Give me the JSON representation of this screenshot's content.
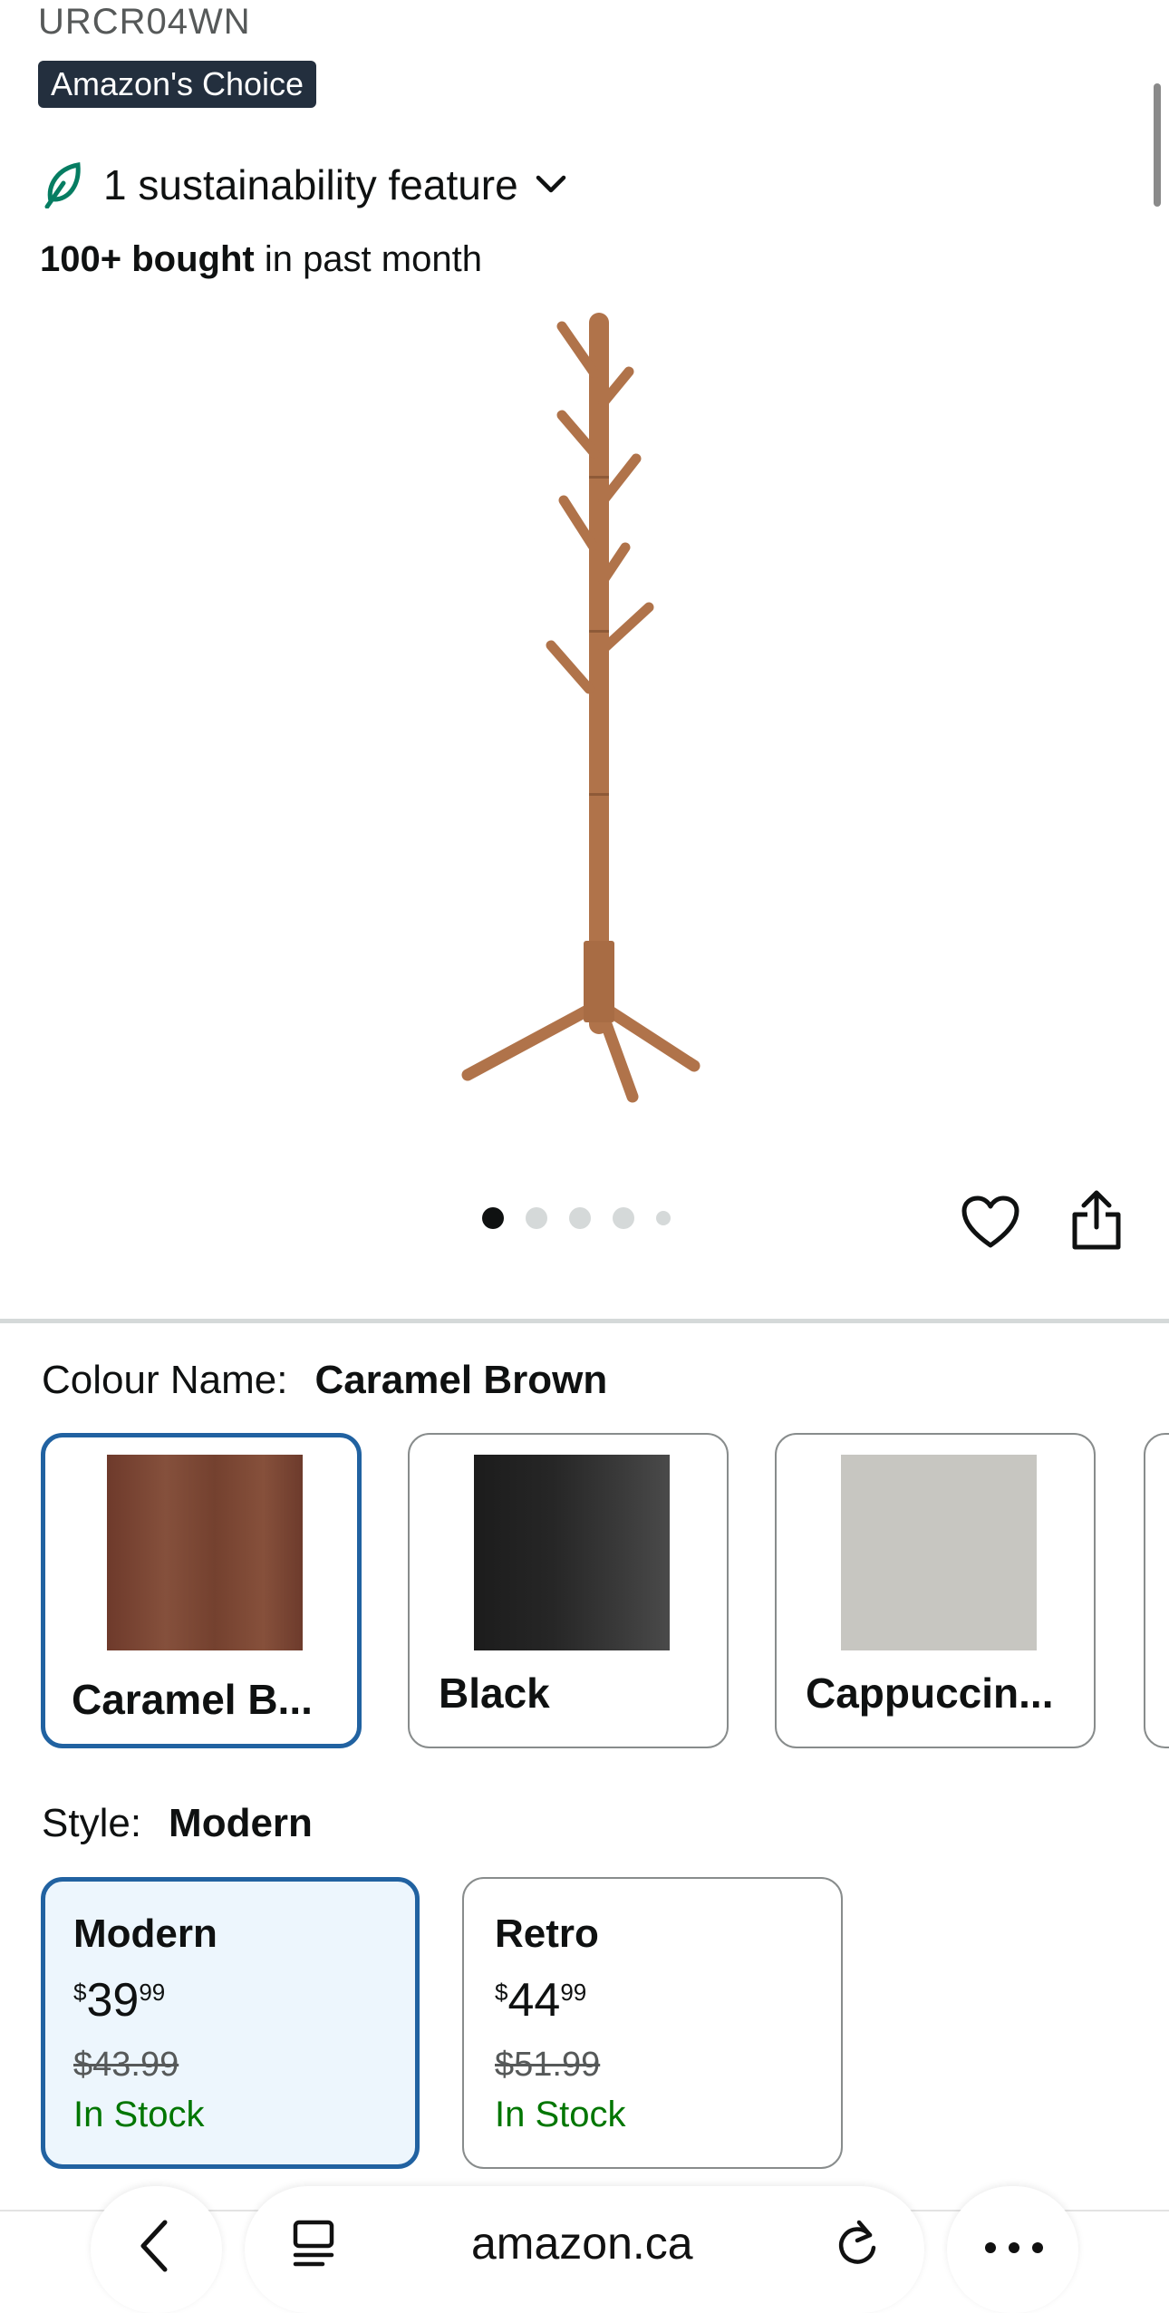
{
  "header": {
    "brand_code": "URCR04WN",
    "badge": "Amazon's Choice",
    "sustainability": "1 sustainability feature",
    "bought_bold": "100+ bought",
    "bought_rest": " in past month"
  },
  "gallery": {
    "image_alt": "Caramel brown wooden coat rack",
    "dots_total": 5,
    "active_dot": 1
  },
  "colour": {
    "label": "Colour Name:",
    "selected": "Caramel Brown",
    "options": [
      {
        "label": "Caramel B...",
        "swatch": "#7a4432"
      },
      {
        "label": "Black",
        "swatch": "#2b2b2b"
      },
      {
        "label": "Cappuccin...",
        "swatch": "#c7c6c1"
      }
    ]
  },
  "style": {
    "label": "Style:",
    "selected": "Modern",
    "options": [
      {
        "name": "Modern",
        "currency": "$",
        "whole": "39",
        "cents": "99",
        "was": "$43.99",
        "stock": "In Stock"
      },
      {
        "name": "Retro",
        "currency": "$",
        "whole": "44",
        "cents": "99",
        "was": "$51.99",
        "stock": "In Stock"
      }
    ]
  },
  "browser": {
    "url": "amazon.ca"
  },
  "colors": {
    "accent": "#2162a1",
    "badge_bg": "#232f3e",
    "in_stock": "#007600"
  }
}
